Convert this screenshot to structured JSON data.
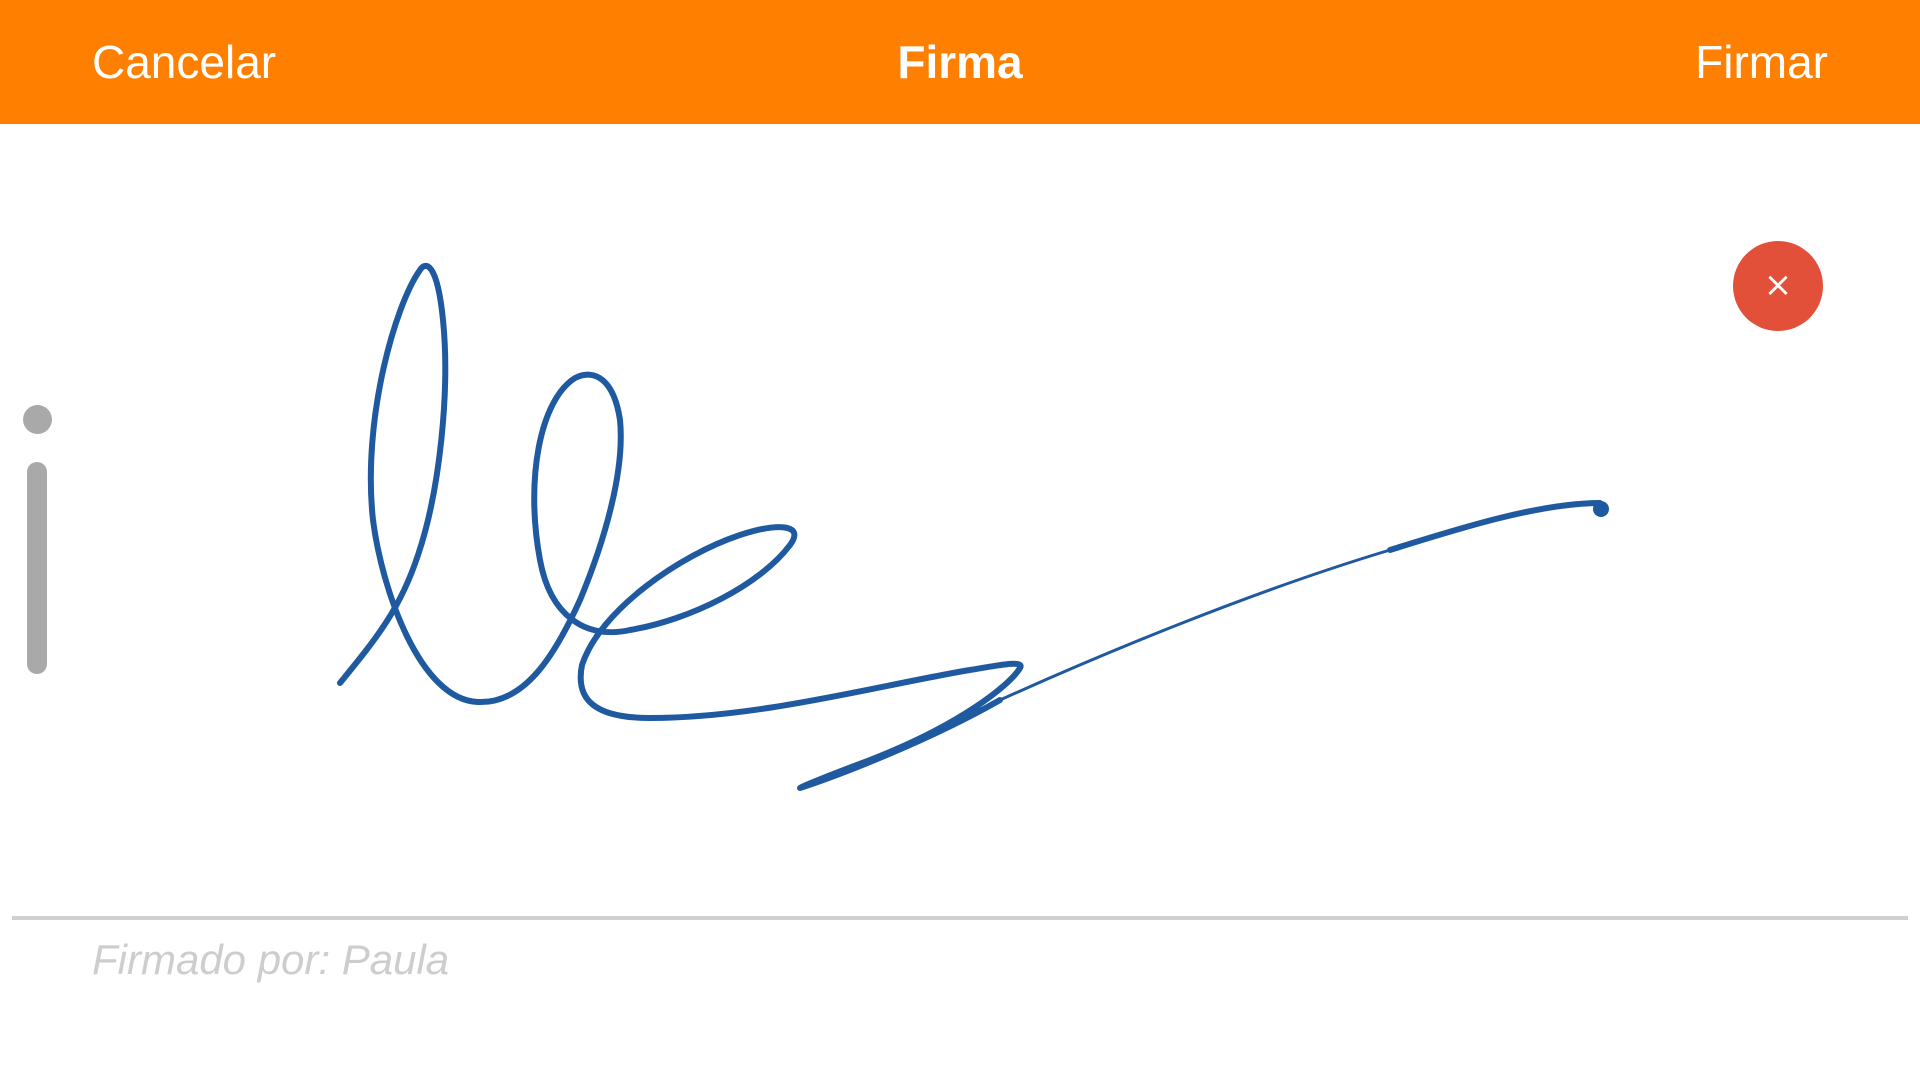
{
  "nav": {
    "cancel_label": "Cancelar",
    "title": "Firma",
    "sign_label": "Firmar"
  },
  "signature_pad": {
    "clear_button_icon": "close-icon",
    "clear_button_symbol": "×",
    "ink_color": "#1f5aa0"
  },
  "footer": {
    "signed_by_text": "Firmado por: Paula"
  },
  "colors": {
    "nav_background": "#ff7f00",
    "clear_button": "#e2503a"
  }
}
